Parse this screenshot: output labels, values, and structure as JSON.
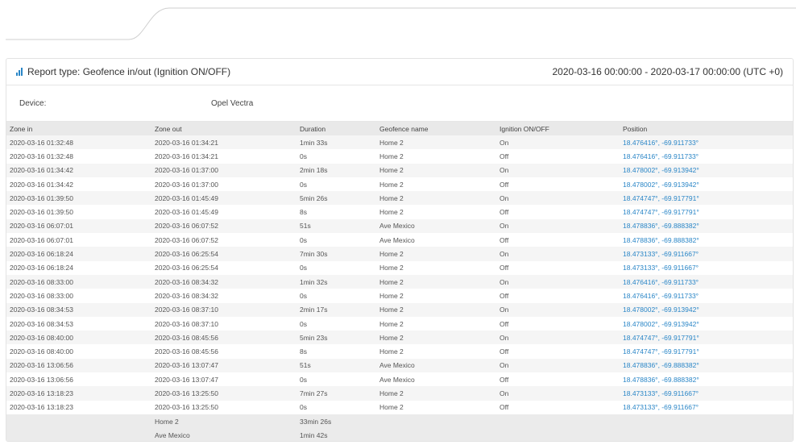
{
  "report": {
    "title": "Report type: Geofence in/out (Ignition ON/OFF)",
    "period": "2020-03-16 00:00:00 - 2020-03-17 00:00:00 (UTC +0)",
    "device_label": "Device:",
    "device_value": "Opel Vectra"
  },
  "table": {
    "headers": [
      "Zone in",
      "Zone out",
      "Duration",
      "Geofence name",
      "Ignition ON/OFF",
      "Position"
    ],
    "rows": [
      [
        "2020-03-16 01:32:48",
        "2020-03-16 01:34:21",
        "1min 33s",
        "Home 2",
        "On",
        "18.476416°, -69.911733°"
      ],
      [
        "2020-03-16 01:32:48",
        "2020-03-16 01:34:21",
        "0s",
        "Home 2",
        "Off",
        "18.476416°, -69.911733°"
      ],
      [
        "2020-03-16 01:34:42",
        "2020-03-16 01:37:00",
        "2min 18s",
        "Home 2",
        "On",
        "18.478002°, -69.913942°"
      ],
      [
        "2020-03-16 01:34:42",
        "2020-03-16 01:37:00",
        "0s",
        "Home 2",
        "Off",
        "18.478002°, -69.913942°"
      ],
      [
        "2020-03-16 01:39:50",
        "2020-03-16 01:45:49",
        "5min 26s",
        "Home 2",
        "On",
        "18.474747°, -69.917791°"
      ],
      [
        "2020-03-16 01:39:50",
        "2020-03-16 01:45:49",
        "8s",
        "Home 2",
        "Off",
        "18.474747°, -69.917791°"
      ],
      [
        "2020-03-16 06:07:01",
        "2020-03-16 06:07:52",
        "51s",
        "Ave Mexico",
        "On",
        "18.478836°, -69.888382°"
      ],
      [
        "2020-03-16 06:07:01",
        "2020-03-16 06:07:52",
        "0s",
        "Ave Mexico",
        "Off",
        "18.478836°, -69.888382°"
      ],
      [
        "2020-03-16 06:18:24",
        "2020-03-16 06:25:54",
        "7min 30s",
        "Home 2",
        "On",
        "18.473133°, -69.911667°"
      ],
      [
        "2020-03-16 06:18:24",
        "2020-03-16 06:25:54",
        "0s",
        "Home 2",
        "Off",
        "18.473133°, -69.911667°"
      ],
      [
        "2020-03-16 08:33:00",
        "2020-03-16 08:34:32",
        "1min 32s",
        "Home 2",
        "On",
        "18.476416°, -69.911733°"
      ],
      [
        "2020-03-16 08:33:00",
        "2020-03-16 08:34:32",
        "0s",
        "Home 2",
        "Off",
        "18.476416°, -69.911733°"
      ],
      [
        "2020-03-16 08:34:53",
        "2020-03-16 08:37:10",
        "2min 17s",
        "Home 2",
        "On",
        "18.478002°, -69.913942°"
      ],
      [
        "2020-03-16 08:34:53",
        "2020-03-16 08:37:10",
        "0s",
        "Home 2",
        "Off",
        "18.478002°, -69.913942°"
      ],
      [
        "2020-03-16 08:40:00",
        "2020-03-16 08:45:56",
        "5min 23s",
        "Home 2",
        "On",
        "18.474747°, -69.917791°"
      ],
      [
        "2020-03-16 08:40:00",
        "2020-03-16 08:45:56",
        "8s",
        "Home 2",
        "Off",
        "18.474747°, -69.917791°"
      ],
      [
        "2020-03-16 13:06:56",
        "2020-03-16 13:07:47",
        "51s",
        "Ave Mexico",
        "On",
        "18.478836°, -69.888382°"
      ],
      [
        "2020-03-16 13:06:56",
        "2020-03-16 13:07:47",
        "0s",
        "Ave Mexico",
        "Off",
        "18.478836°, -69.888382°"
      ],
      [
        "2020-03-16 13:18:23",
        "2020-03-16 13:25:50",
        "7min 27s",
        "Home 2",
        "On",
        "18.473133°, -69.911667°"
      ],
      [
        "2020-03-16 13:18:23",
        "2020-03-16 13:25:50",
        "0s",
        "Home 2",
        "Off",
        "18.473133°, -69.911667°"
      ]
    ],
    "summary": [
      {
        "name": "Home 2",
        "duration": "33min 26s"
      },
      {
        "name": "Ave Mexico",
        "duration": "1min 42s"
      }
    ]
  },
  "colors": {
    "accent": "#2a86c7",
    "header_bg": "#e9e9e9",
    "stripe": "#f5f5f5"
  }
}
